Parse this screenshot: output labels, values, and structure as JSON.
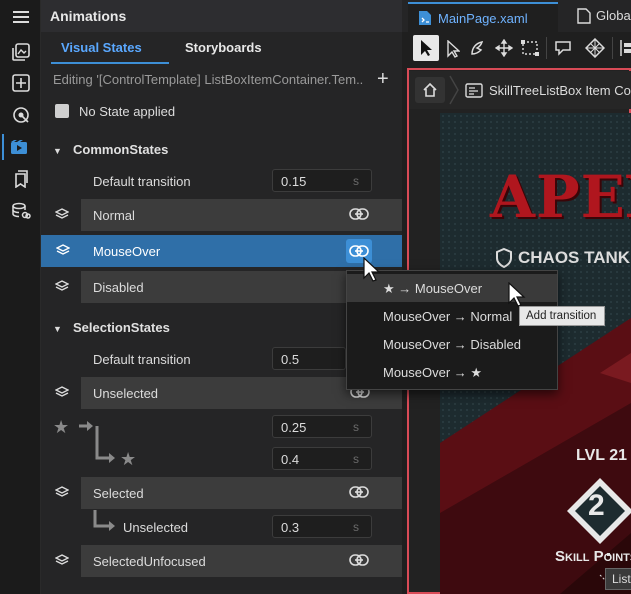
{
  "panel": {
    "title": "Animations",
    "tabs": [
      {
        "label": "Visual States"
      },
      {
        "label": "Storyboards"
      }
    ],
    "editing": "Editing '[ControlTemplate] ListBoxItemContainer.Tem...",
    "add_label": "+",
    "no_state": "No State applied"
  },
  "groups": [
    {
      "name": "CommonStates",
      "default_transition_label": "Default transition",
      "default_transition_value": "0.15",
      "unit": "s",
      "states": [
        {
          "label": "Normal"
        },
        {
          "label": "MouseOver"
        },
        {
          "label": "Disabled"
        }
      ]
    },
    {
      "name": "SelectionStates",
      "default_transition_label": "Default transition",
      "default_transition_value": "0.5",
      "unit": "s",
      "states": [
        {
          "label": "Unselected"
        },
        {
          "label": "Selected"
        },
        {
          "label": "SelectedUnfocused"
        }
      ],
      "transitions": [
        {
          "from": "★",
          "to": "",
          "value": "0.25",
          "unit": "s"
        },
        {
          "from": "",
          "to": "★",
          "value": "0.4",
          "unit": "s"
        },
        {
          "from": "Selected",
          "to": "Unselected",
          "value": "0.3",
          "unit": "s"
        }
      ]
    }
  ],
  "dropdown": {
    "items": [
      {
        "label": "★ → MouseOver"
      },
      {
        "label": "MouseOver → Normal"
      },
      {
        "label": "MouseOver → Disabled"
      },
      {
        "label": "MouseOver → ★"
      }
    ],
    "tooltip": "Add transition"
  },
  "editor": {
    "tabs": [
      {
        "label": "MainPage.xaml"
      },
      {
        "label": "Globa"
      }
    ],
    "breadcrumb": "SkillTreeListBox Item Conta",
    "artwork": {
      "title": "APEX",
      "subtitle": "CHAOS TANK",
      "level": "LVL 21",
      "number": "2",
      "points": "Skill Points"
    },
    "bottom_tip": "List"
  },
  "colors": {
    "accent": "#3d8fd6",
    "selected_row": "#2f6fa8",
    "frame": "#d94b57",
    "art_red": "#b0161e"
  }
}
